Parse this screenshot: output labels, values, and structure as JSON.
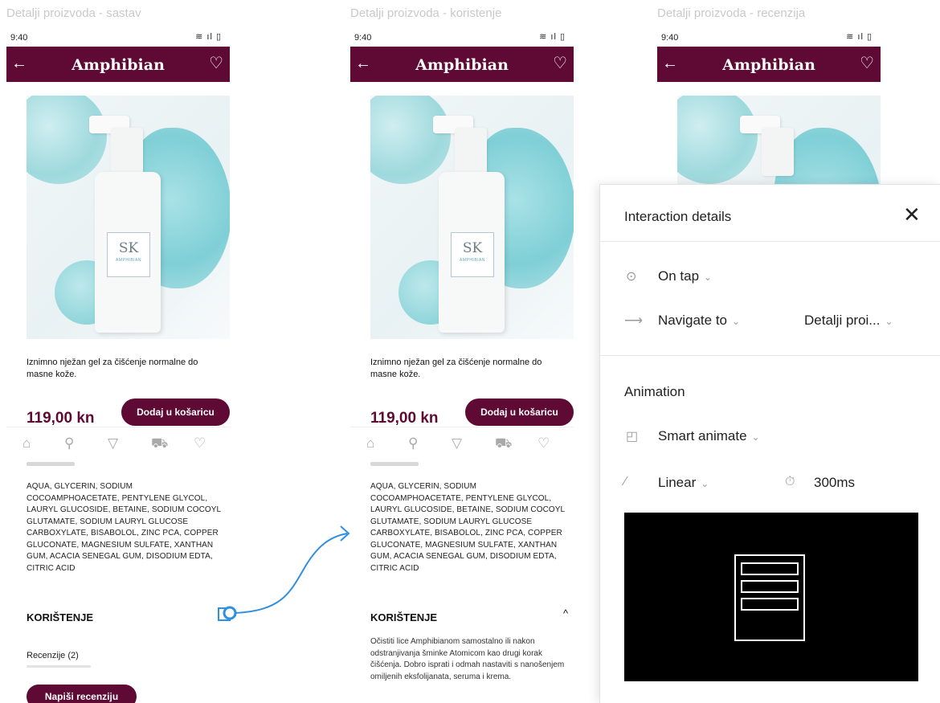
{
  "frames": [
    {
      "title": "Detalji proizvoda - sastav",
      "time": "9:40",
      "app_title": "Amphibian",
      "description": "Iznimno nježan gel za čišćenje normalne do masne kože.",
      "price": "119,00 kn",
      "add_to_cart": "Dodaj u košaricu",
      "ingredients": "AQUA, GLYCERIN, SODIUM COCOAMPHOACETATE, PENTYLENE GLYCOL, LAURYL GLUCOSIDE, BETAINE, SODIUM COCOYL GLUTAMATE, SODIUM LAURYL GLUCOSE CARBOXYLATE, BISABOLOL, ZINC PCA, COPPER GLUCONATE, MAGNESIUM SULFATE, XANTHAN GUM, ACACIA SENEGAL GUM, DISODIUM EDTA, CITRIC ACID",
      "usage_heading": "KORIŠTENJE",
      "reviews_label": "Recenzije (2)",
      "write_review": "Napiši recenziju"
    },
    {
      "title": "Detalji proizvoda - koristenje",
      "time": "9:40",
      "app_title": "Amphibian",
      "description": "Iznimno nježan gel za čišćenje normalne do masne kože.",
      "price": "119,00 kn",
      "add_to_cart": "Dodaj u košaricu",
      "ingredients": "AQUA, GLYCERIN, SODIUM COCOAMPHOACETATE, PENTYLENE GLYCOL, LAURYL GLUCOSIDE, BETAINE, SODIUM COCOYL GLUTAMATE, SODIUM LAURYL GLUCOSE CARBOXYLATE, BISABOLOL, ZINC PCA, COPPER GLUCONATE, MAGNESIUM SULFATE, XANTHAN GUM, ACACIA SENEGAL GUM, DISODIUM EDTA, CITRIC ACID",
      "usage_heading": "KORIŠTENJE",
      "usage_text": "Očistiti lice Amphibianom samostalno ili nakon odstranjivanja šminke Atomicom kao drugi korak čišćenja. Dobro isprati i odmah nastaviti s nanošenjem omiljenih eksfolijanata, seruma i krema."
    },
    {
      "title": "Detalji proizvoda - recenzija",
      "time": "9:40",
      "app_title": "Amphibian"
    }
  ],
  "bottle_label": {
    "monogram": "SK",
    "brand": "AMPHIBIAN"
  },
  "nav_icons": [
    "home-icon",
    "search-icon",
    "filter-icon",
    "cart-icon",
    "heart-icon"
  ],
  "interaction_panel": {
    "title": "Interaction details",
    "trigger": "On tap",
    "action": "Navigate to",
    "destination": "Detalji proi...",
    "animation_heading": "Animation",
    "animation_type": "Smart animate",
    "easing": "Linear",
    "duration": "300ms"
  },
  "colors": {
    "brand": "#5e0a35",
    "connector": "#2f8fe0"
  }
}
